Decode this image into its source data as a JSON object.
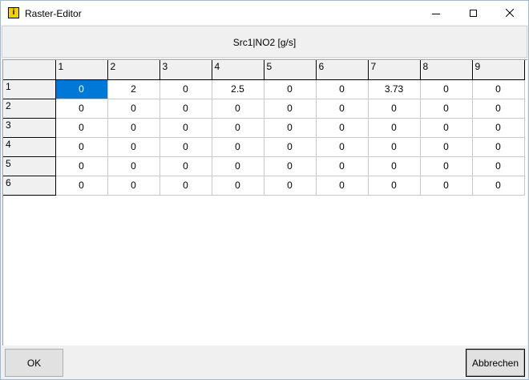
{
  "window": {
    "title": "Raster-Editor"
  },
  "header": {
    "label": "Src1|NO2 [g/s]"
  },
  "grid": {
    "columns": [
      "1",
      "2",
      "3",
      "4",
      "5",
      "6",
      "7",
      "8",
      "9"
    ],
    "rows": [
      {
        "label": "1",
        "cells": [
          "0",
          "2",
          "0",
          "2.5",
          "0",
          "0",
          "3.73",
          "0",
          "0"
        ]
      },
      {
        "label": "2",
        "cells": [
          "0",
          "0",
          "0",
          "0",
          "0",
          "0",
          "0",
          "0",
          "0"
        ]
      },
      {
        "label": "3",
        "cells": [
          "0",
          "0",
          "0",
          "0",
          "0",
          "0",
          "0",
          "0",
          "0"
        ]
      },
      {
        "label": "4",
        "cells": [
          "0",
          "0",
          "0",
          "0",
          "0",
          "0",
          "0",
          "0",
          "0"
        ]
      },
      {
        "label": "5",
        "cells": [
          "0",
          "0",
          "0",
          "0",
          "0",
          "0",
          "0",
          "0",
          "0"
        ]
      },
      {
        "label": "6",
        "cells": [
          "0",
          "0",
          "0",
          "0",
          "0",
          "0",
          "0",
          "0",
          "0"
        ]
      }
    ],
    "selected": {
      "row": 0,
      "col": 0
    },
    "selection_color": "#0078d7"
  },
  "buttons": {
    "ok_label": "OK",
    "cancel_label": "Abbrechen"
  },
  "icons": {
    "app": "raster-editor-app-icon",
    "minimize": "minimize-icon",
    "maximize": "maximize-icon",
    "close": "close-icon"
  }
}
